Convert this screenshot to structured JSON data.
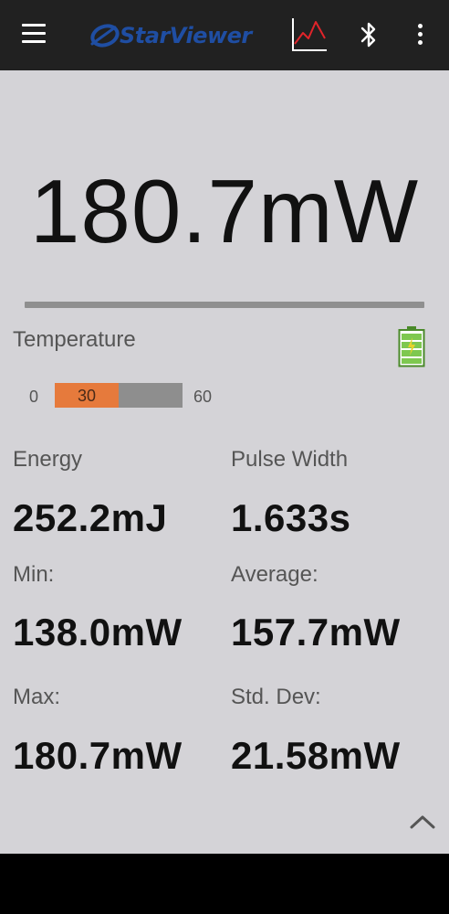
{
  "app": {
    "logo_text": "StarViewer",
    "brand_color": "#1f4ea3"
  },
  "toolbar": {
    "menu_icon": "hamburger-menu-icon",
    "chart_icon": "line-chart-icon",
    "bluetooth_icon": "bluetooth-icon",
    "more_icon": "more-vertical-icon"
  },
  "reading": {
    "value": "180.7mW"
  },
  "temperature": {
    "label": "Temperature",
    "scale_min": "0",
    "scale_max": "60",
    "value": "30",
    "fill_fraction": 0.5,
    "fill_color": "#e67a3c"
  },
  "battery": {
    "icon": "battery-charging-icon",
    "level_fraction": 0.85,
    "color": "#7ec850"
  },
  "stats": {
    "energy_label": "Energy",
    "energy_value": "252.2mJ",
    "pulse_width_label": "Pulse Width",
    "pulse_width_value": "1.633s",
    "min_label": "Min:",
    "min_value": "138.0mW",
    "average_label": "Average:",
    "average_value": "157.7mW",
    "max_label": "Max:",
    "max_value": "180.7mW",
    "std_dev_label": "Std. Dev:",
    "std_dev_value": "21.58mW"
  },
  "footer": {
    "collapse_icon": "chevron-up-icon"
  }
}
